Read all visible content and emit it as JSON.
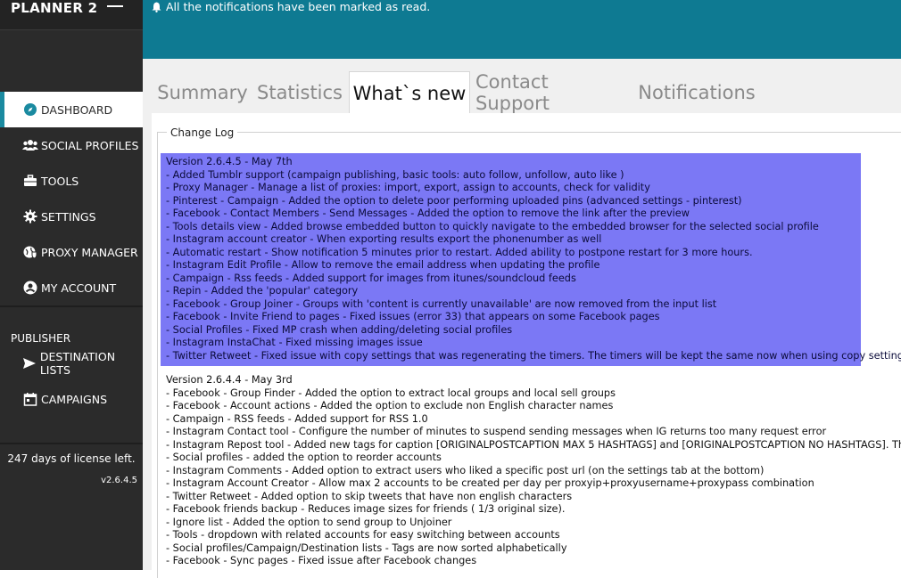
{
  "app": {
    "title": "PLANNER 2"
  },
  "notification": {
    "message": "All the notifications have been marked as read."
  },
  "sidebar": {
    "items": [
      {
        "label": "DASHBOARD",
        "icon": "compass-icon",
        "active": true
      },
      {
        "label": "SOCIAL PROFILES",
        "icon": "users-icon"
      },
      {
        "label": "TOOLS",
        "icon": "briefcase-icon"
      },
      {
        "label": "SETTINGS",
        "icon": "gear-icon"
      },
      {
        "label": "PROXY MANAGER",
        "icon": "globe-shield-icon"
      },
      {
        "label": "MY ACCOUNT",
        "icon": "account-circle-icon"
      }
    ],
    "publisher_label": "PUBLISHER",
    "publisher_items": [
      {
        "label": "DESTINATION LISTS",
        "icon": "send-icon"
      },
      {
        "label": "CAMPAIGNS",
        "icon": "calendar-icon"
      }
    ],
    "license_text": "247 days of license left.",
    "version": "v2.6.4.5"
  },
  "tabs": [
    {
      "label": "Summary"
    },
    {
      "label": "Statistics"
    },
    {
      "label": "What`s new",
      "active": true
    },
    {
      "label": "Contact Support"
    },
    {
      "label": "Notifications"
    }
  ],
  "changelog": {
    "legend": "Change Log",
    "selected_block": [
      "Version 2.6.4.5 - May 7th",
      "- Added Tumblr support (campaign publishing, basic tools: auto follow, unfollow, auto like )",
      "- Proxy Manager - Manage a list of proxies: import, export, assign to accounts, check for validity",
      "- Pinterest - Campaign - Added the option to delete poor performing uploaded pins (advanced settings - pinterest)",
      "- Facebook - Contact Members - Send Messages - Added the option to remove the link after the preview",
      "- Tools details view - Added browse embedded button to quickly navigate to the embedded browser for the selected social profile",
      "- Instagram account creator - When exporting results export the phonenumber as well",
      "- Automatic restart - Show notification 5 minutes prior to restart. Added ability to postpone restart for 3 more hours.",
      "- Instagram Edit Profile - Allow to remove the email address when updating the profile",
      "- Campaign - Rss feeds - Added support for images from itunes/soundcloud feeds",
      "- Repin - Added the 'popular' category",
      "- Facebook - Group Joiner - Groups with 'content is currently unavailable' are now removed from the input list",
      "- Facebook - Invite Friend to pages - Fixed issues (error 33) that appears on some Facebook pages",
      "- Social Profiles - Fixed MP crash when adding/deleting social profiles",
      "- Instagram InstaChat - Fixed missing images issue",
      "- Twitter Retweet - Fixed issue with copy settings that was regenerating the timers. The timers will be kept the same now when using copy settings."
    ],
    "normal_block": [
      "Version 2.6.4.4 - May 3rd",
      "- Facebook - Group Finder - Added the option to extract local groups and local sell groups",
      "- Facebook - Account actions - Added the option to exclude non English character names",
      "- Campaign - RSS feeds - Added support for RSS 1.0",
      "- Instagram Contact tool - Configure the number of minutes to suspend sending messages when IG returns too many request error",
      "- Instagram Repost tool - Added new tags for caption [ORIGINALPOSTCAPTION MAX 5 HASHTAGS] and [ORIGINALPOSTCAPTION NO HASHTAGS]. The first",
      "- Social profiles - added the option to reorder accounts",
      "- Instagram Comments - Added option to extract users who liked a specific post url (on the settings tab at the bottom)",
      "- Instagram Account Creator - Allow max 2 accounts to be created per day per proxyip+proxyusername+proxypass combination",
      "- Twitter Retweet - Added option to skip tweets that have non english characters",
      "- Facebook friends backup - Reduces image sizes for friends ( 1/3 original size).",
      "- Ignore list - Added the option to send group to Unjoiner",
      "- Tools - dropdown with related accounts for easy switching between accounts",
      "- Social profiles/Campaign/Destination lists - Tags are now sorted alphabetically",
      "- Facebook - Sync pages - Fixed issue after Facebook changes"
    ]
  },
  "colors": {
    "sidebar_bg": "#2b2b2b",
    "topbar_bg": "#0e7a92",
    "accent": "#1a8aa0",
    "selection_bg": "#7b78f5"
  }
}
